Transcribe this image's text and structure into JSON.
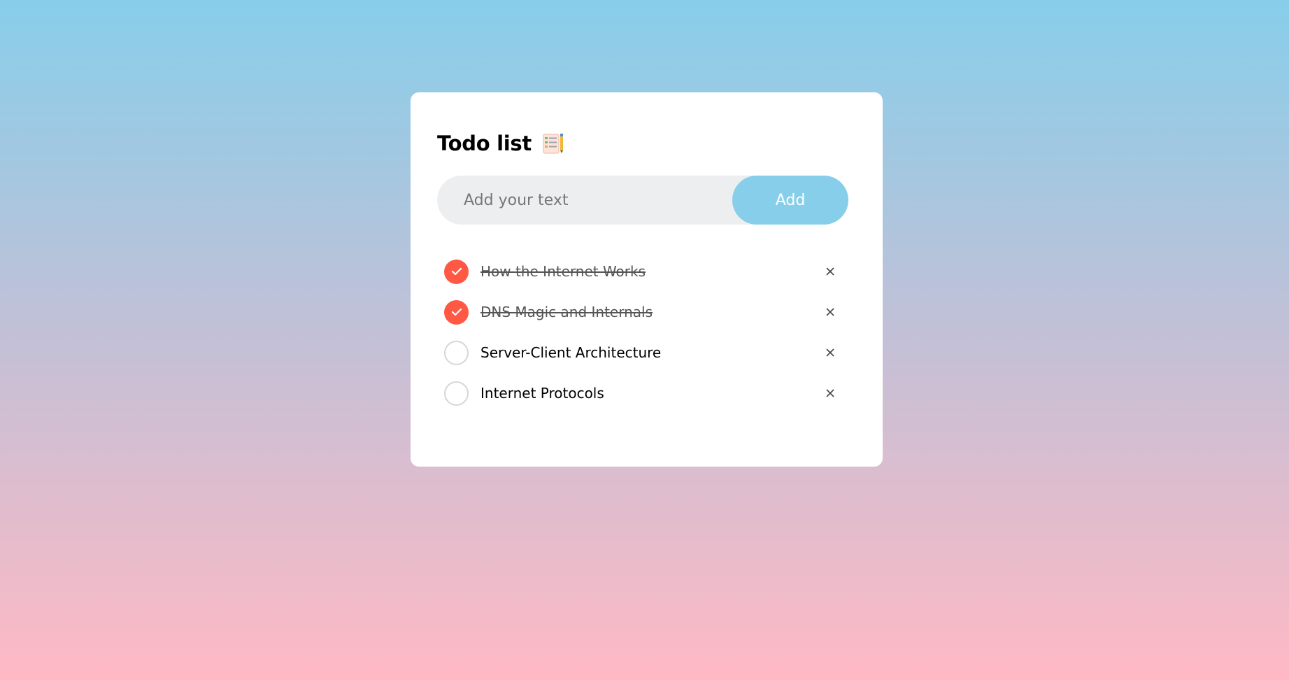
{
  "app": {
    "title": "Todo list",
    "title_icon": "notepad-checklist-icon"
  },
  "input": {
    "value": "",
    "placeholder": "Add your text",
    "add_label": "Add"
  },
  "colors": {
    "accent": "#87ceea",
    "checked": "#ff5945",
    "gradient_top": "#87ceea",
    "gradient_bottom": "#ffb9c4"
  },
  "todos": [
    {
      "text": "How the Internet Works",
      "done": true
    },
    {
      "text": "DNS Magic and Internals",
      "done": true
    },
    {
      "text": "Server-Client Architecture",
      "done": false
    },
    {
      "text": "Internet Protocols",
      "done": false
    }
  ],
  "icons": {
    "check": "check-icon",
    "remove": "close-icon"
  }
}
